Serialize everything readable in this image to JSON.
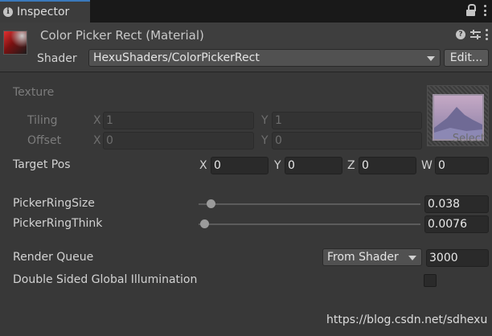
{
  "tab": {
    "icon": "info-icon",
    "label": "Inspector"
  },
  "tab_tools": {
    "lock_icon": "lock-icon",
    "menu_icon": "kebab-menu-icon"
  },
  "header": {
    "title": "Color Picker Rect (Material)",
    "preview_icon": "material-preview-icon",
    "icons": [
      "help-icon",
      "presets-icon",
      "kebab-menu-icon"
    ],
    "shader_label": "Shader",
    "shader_value": "HexuShaders/ColorPickerRect",
    "edit_label": "Edit..."
  },
  "texture": {
    "label": "Texture",
    "tiling": {
      "label": "Tiling",
      "x_label": "X",
      "x": "1",
      "y_label": "Y",
      "y": "1"
    },
    "offset": {
      "label": "Offset",
      "x_label": "X",
      "x": "0",
      "y_label": "Y",
      "y": "0"
    },
    "select_label": "Select"
  },
  "target_pos": {
    "label": "Target Pos",
    "x_label": "X",
    "x": "0",
    "y_label": "Y",
    "y": "0",
    "z_label": "Z",
    "z": "0",
    "w_label": "W",
    "w": "0"
  },
  "sliders": [
    {
      "label": "PickerRingSize",
      "value": "0.038",
      "fraction": 0.038
    },
    {
      "label": "PickerRingThink",
      "value": "0.0076",
      "fraction": 0.0076
    }
  ],
  "render_queue": {
    "label": "Render Queue",
    "mode": "From Shader",
    "value": "3000"
  },
  "double_sided_gi": {
    "label": "Double Sided Global Illumination",
    "checked": false
  },
  "watermark": "https://blog.csdn.net/sdhexu",
  "colors": {
    "background": "#383838",
    "accent": "#3a79bb",
    "field": "#2a2a2a"
  }
}
